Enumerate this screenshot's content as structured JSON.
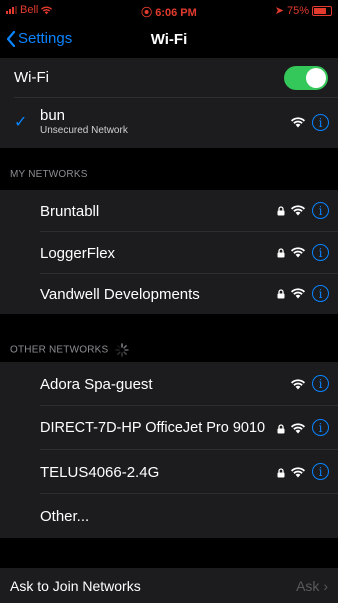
{
  "status_bar": {
    "carrier": "Bell",
    "time": "6:06 PM",
    "battery": "75%",
    "battery_level": 0.75
  },
  "nav": {
    "back_label": "Settings",
    "title": "Wi-Fi"
  },
  "wifi_toggle": {
    "label": "Wi-Fi",
    "on": true
  },
  "current_network": {
    "name": "bun",
    "subtext": "Unsecured Network"
  },
  "my_networks": {
    "header": "MY NETWORKS",
    "items": [
      {
        "name": "Bruntabll",
        "locked": true
      },
      {
        "name": "LoggerFlex",
        "locked": true
      },
      {
        "name": "Vandwell Developments",
        "locked": true
      }
    ]
  },
  "other_networks": {
    "header": "OTHER NETWORKS",
    "items": [
      {
        "name": "Adora Spa-guest",
        "locked": false
      },
      {
        "name": "DIRECT-7D-HP OfficeJet Pro 9010",
        "locked": true
      },
      {
        "name": "TELUS4066-2.4G",
        "locked": true
      }
    ],
    "other_label": "Other..."
  },
  "ask_to_join": {
    "label": "Ask to Join Networks",
    "value": "Ask"
  },
  "colors": {
    "accent": "#0a84ff",
    "toggle_on": "#34c759",
    "status_red": "#e23b2e"
  },
  "icons": [
    "wifi-icon",
    "lock-icon",
    "info-icon",
    "chevron-left-icon",
    "checkmark-icon",
    "spinner-icon",
    "chevron-right-icon"
  ]
}
